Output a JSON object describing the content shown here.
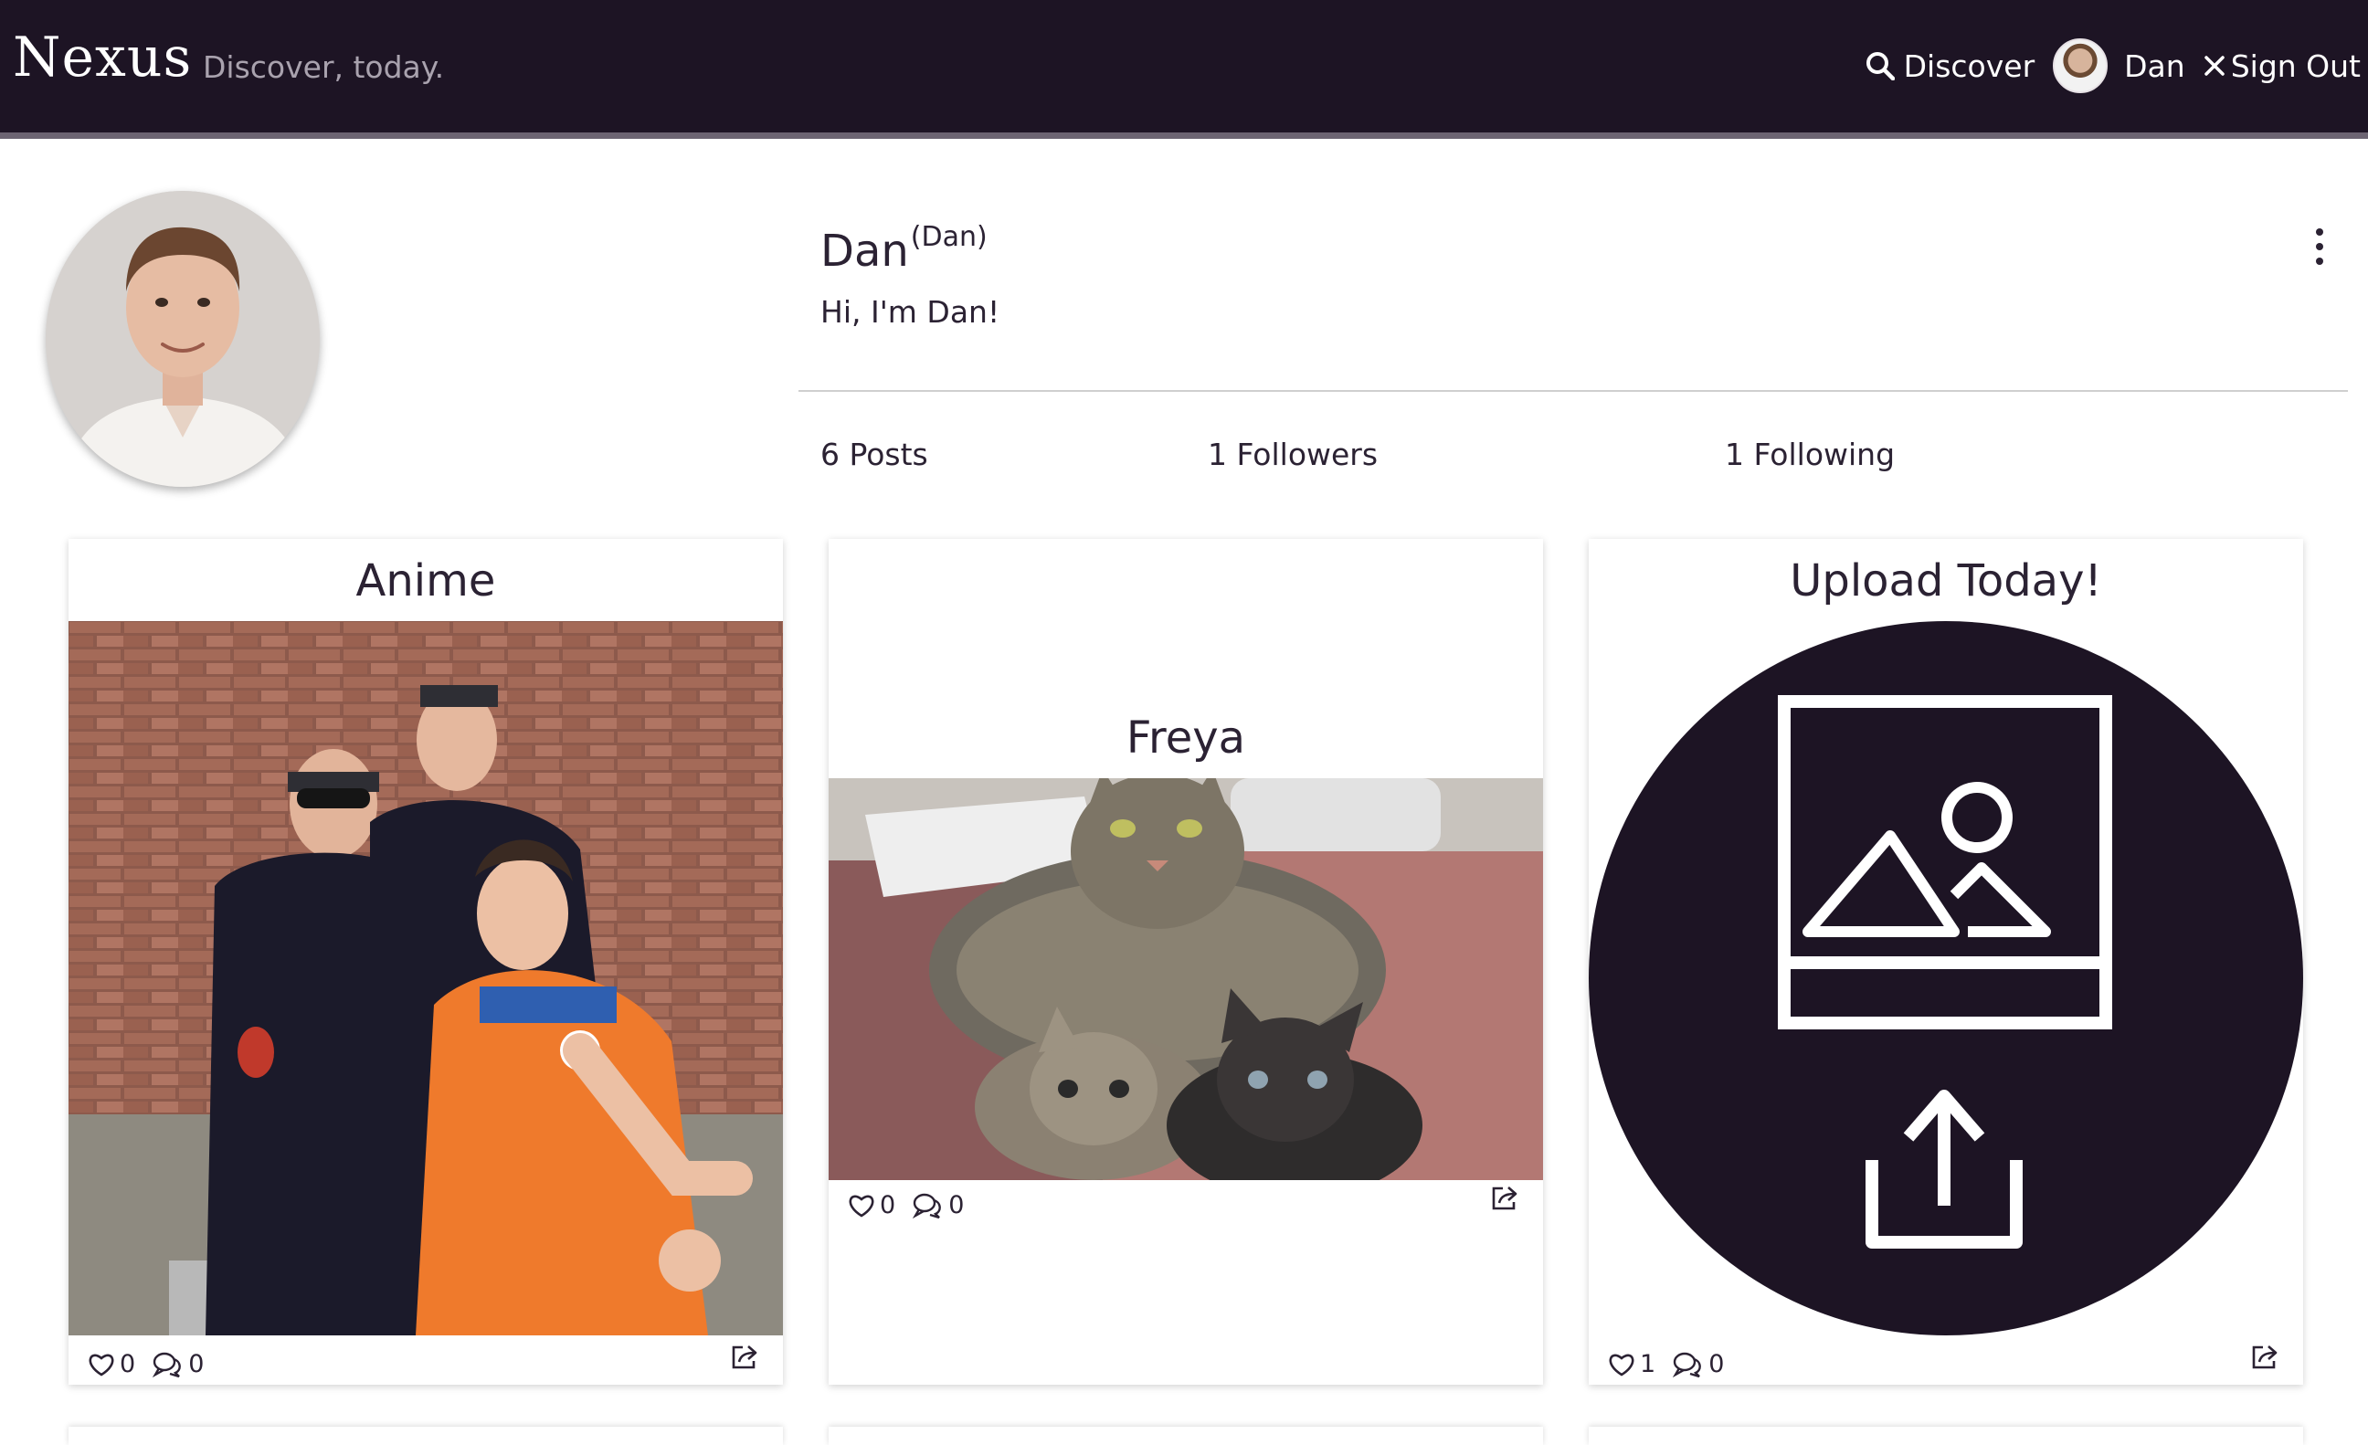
{
  "navbar": {
    "brand": "Nexus",
    "tagline": "Discover, today.",
    "discover_label": "Discover",
    "user_label": "Dan",
    "signout_label": "Sign Out"
  },
  "profile": {
    "name": "Dan",
    "handle": "(Dan)",
    "bio": "Hi, I'm Dan!",
    "stats": {
      "posts": "6 Posts",
      "followers": "1 Followers",
      "following": "1 Following"
    }
  },
  "posts": [
    {
      "title": "Anime",
      "likes": "0",
      "comments": "0",
      "image": "photo of three people in anime cosplay against a brick wall"
    },
    {
      "title": "Freya",
      "likes": "0",
      "comments": "0",
      "image": "photo of a tabby cat with two kittens on a rug"
    },
    {
      "title": "Upload Today!",
      "likes": "1",
      "comments": "0",
      "image": "upload-placeholder-icon"
    }
  ],
  "colors": {
    "navbar_bg": "#1d1424",
    "text": "#2b2233",
    "upload_circle": "#1d1424"
  }
}
